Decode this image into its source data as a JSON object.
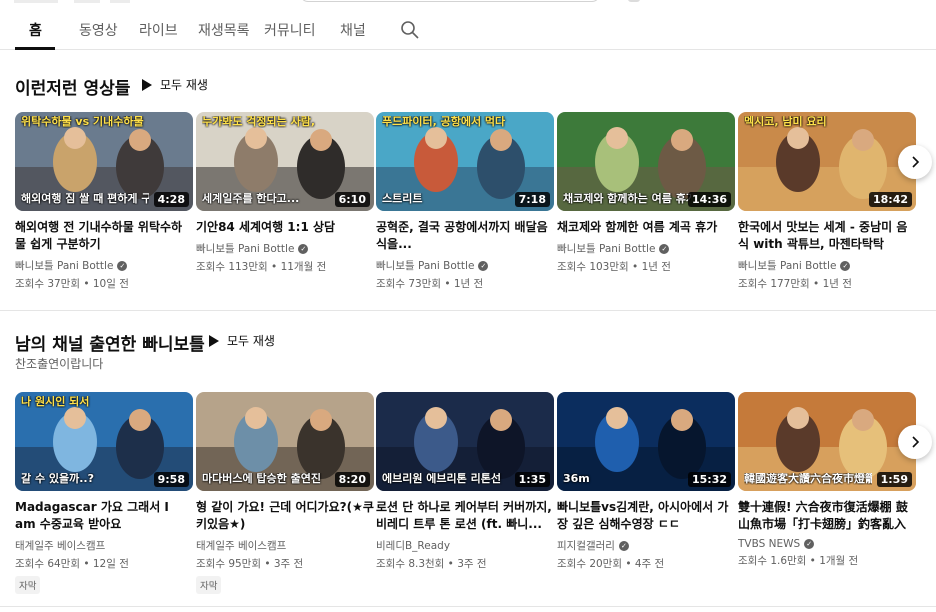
{
  "tabs": [
    "홈",
    "동영상",
    "라이브",
    "재생목록",
    "커뮤니티",
    "채널"
  ],
  "icons": {
    "search": "search-icon",
    "play": "play-icon",
    "next": "chevron-right-icon",
    "verified": "check-circle-icon"
  },
  "sections": [
    {
      "title": "이런저런 영상들",
      "play_all": "모두 재생",
      "videos": [
        {
          "caption": "위탁수하물 vs 기내수하물",
          "caption2": "해외여행 짐 쌀 때 편하게 구분하는 법",
          "duration": "4:28",
          "title": "해외여행 전 기내수하물 위탁수하물 쉽게 구분하기",
          "channel": "빠니보틀 Pani Bottle",
          "verified": true,
          "views": "조회수 37만회",
          "age": "10일 전",
          "colors": [
            "#6a7b8e",
            "#c9a36b",
            "#3f3a3a"
          ]
        },
        {
          "caption": "누가봐도 걱정되는 사람,",
          "caption2": "세계일주를 한다고...",
          "duration": "6:10",
          "title": "기안84 세계여행 1:1 상담",
          "channel": "빠니보틀 Pani Bottle",
          "verified": true,
          "views": "조회수 113만회",
          "age": "11개월 전",
          "colors": [
            "#d8d3c7",
            "#8e7c6a",
            "#2f2c2a"
          ]
        },
        {
          "caption": "푸드파이터, 공항에서 먹다",
          "caption2": "스트리트",
          "duration": "7:18",
          "title": "공혁준, 결국 공항에서까지 배달음식을...",
          "channel": "빠니보틀 Pani Bottle",
          "verified": true,
          "views": "조회수 73만회",
          "age": "1년 전",
          "colors": [
            "#4aa7c7",
            "#c85a3a",
            "#2d4f6b"
          ]
        },
        {
          "caption": "",
          "caption2": "채코제와 함께하는 여름 휴가",
          "duration": "14:36",
          "title": "채코제와 함께한 여름 계곡 휴가",
          "channel": "빠니보틀 Pani Bottle",
          "verified": true,
          "views": "조회수 103만회",
          "age": "1년 전",
          "colors": [
            "#3d7a3a",
            "#a8c07a",
            "#6d5a45"
          ]
        },
        {
          "caption": "멕시코, 남미 요리",
          "caption2": "",
          "duration": "18:42",
          "title": "한국에서 맛보는 세계 - 중남미 음식 with 곽튜브, 마젠타탁탁",
          "channel": "빠니보틀 Pani Bottle",
          "verified": true,
          "views": "조회수 177만회",
          "age": "1년 전",
          "colors": [
            "#c98a4a",
            "#5a3a2a",
            "#e0b56e"
          ]
        }
      ]
    },
    {
      "title": "남의 채널 출연한 빠니보틀",
      "play_all": "모두 재생",
      "subtitle": "찬조출연이랍니다",
      "videos": [
        {
          "caption": "나 원시인 되서",
          "caption2": "갈 수 있을까..?",
          "duration": "9:58",
          "title": "Madagascar 가요 그래서 I am 수중교육 받아요",
          "channel": "태계일주 베이스캠프",
          "verified": false,
          "views": "조회수 64만회",
          "age": "12일 전",
          "badge": "자막",
          "colors": [
            "#2a6fae",
            "#7fb6e0",
            "#1d2f4a"
          ]
        },
        {
          "caption": "",
          "caption2": "마다버스에 탑승한 출연진",
          "duration": "8:20",
          "title": "형 같이 가요! 근데 어디가요?(★쿠키있음★)",
          "channel": "태계일주 베이스캠프",
          "verified": false,
          "views": "조회수 95만회",
          "age": "3주 전",
          "badge": "자막",
          "colors": [
            "#b6a38a",
            "#6d8fa8",
            "#3a332c"
          ]
        },
        {
          "caption": "",
          "caption2": "에브리원 에브리톤 리톤선",
          "duration": "1:35",
          "title": "로션 단 하나로 케어부터 커버까지, 비레디 트루 톤 로션 (ft. 빠니...",
          "channel": "비레디B_Ready",
          "verified": false,
          "views": "조회수 8.3천회",
          "age": "3주 전",
          "colors": [
            "#1b2b4a",
            "#3c5a8a",
            "#0e1528"
          ]
        },
        {
          "caption": "",
          "caption2": "36m",
          "duration": "15:32",
          "title": "빠니보틀vs김계란, 아시아에서 가장 깊은 심해수영장 ㄷㄷ",
          "channel": "피지컬갤러리",
          "verified": true,
          "views": "조회수 20만회",
          "age": "4주 전",
          "colors": [
            "#0b2d5e",
            "#1f5fae",
            "#06162e"
          ]
        },
        {
          "caption": "",
          "caption2": "韓國遊客大讚六合夜市燈籠",
          "duration": "1:59",
          "title": "雙十連假! 六合夜市復活爆棚 鼓山魚市場「打卡翅膀」釣客亂入｜...",
          "channel": "TVBS NEWS",
          "verified": true,
          "views": "조회수 1.6만회",
          "age": "1개월 전",
          "colors": [
            "#c57a3a",
            "#5a3a2a",
            "#e6c07a"
          ]
        }
      ]
    }
  ]
}
